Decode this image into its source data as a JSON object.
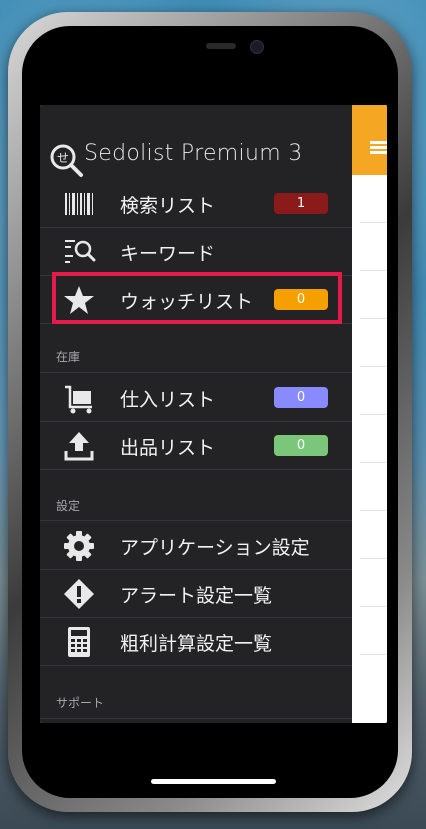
{
  "app": {
    "title": "Sedolist Premium 3"
  },
  "menu": {
    "items": [
      {
        "label": "検索リスト",
        "badge": "1",
        "badge_color": "#8b1a1a",
        "icon": "barcode-icon"
      },
      {
        "label": "キーワード",
        "icon": "keyword-search-icon"
      },
      {
        "label": "ウォッチリスト",
        "badge": "0",
        "badge_color": "#f5a000",
        "icon": "star-icon"
      }
    ]
  },
  "inventory": {
    "section_label": "在庫",
    "items": [
      {
        "label": "仕入リスト",
        "badge": "0",
        "badge_color": "#8a8aff",
        "icon": "cart-icon"
      },
      {
        "label": "出品リスト",
        "badge": "0",
        "badge_color": "#7ac77a",
        "icon": "upload-icon"
      }
    ]
  },
  "settings": {
    "section_label": "設定",
    "items": [
      {
        "label": "アプリケーション設定",
        "icon": "gear-icon"
      },
      {
        "label": "アラート設定一覧",
        "icon": "warning-icon"
      },
      {
        "label": "粗利計算設定一覧",
        "icon": "calculator-icon"
      }
    ]
  },
  "support": {
    "section_label": "サポート"
  },
  "colors": {
    "drawer_bg": "#232326",
    "accent": "#f5a623",
    "highlight": "#e6194b"
  }
}
